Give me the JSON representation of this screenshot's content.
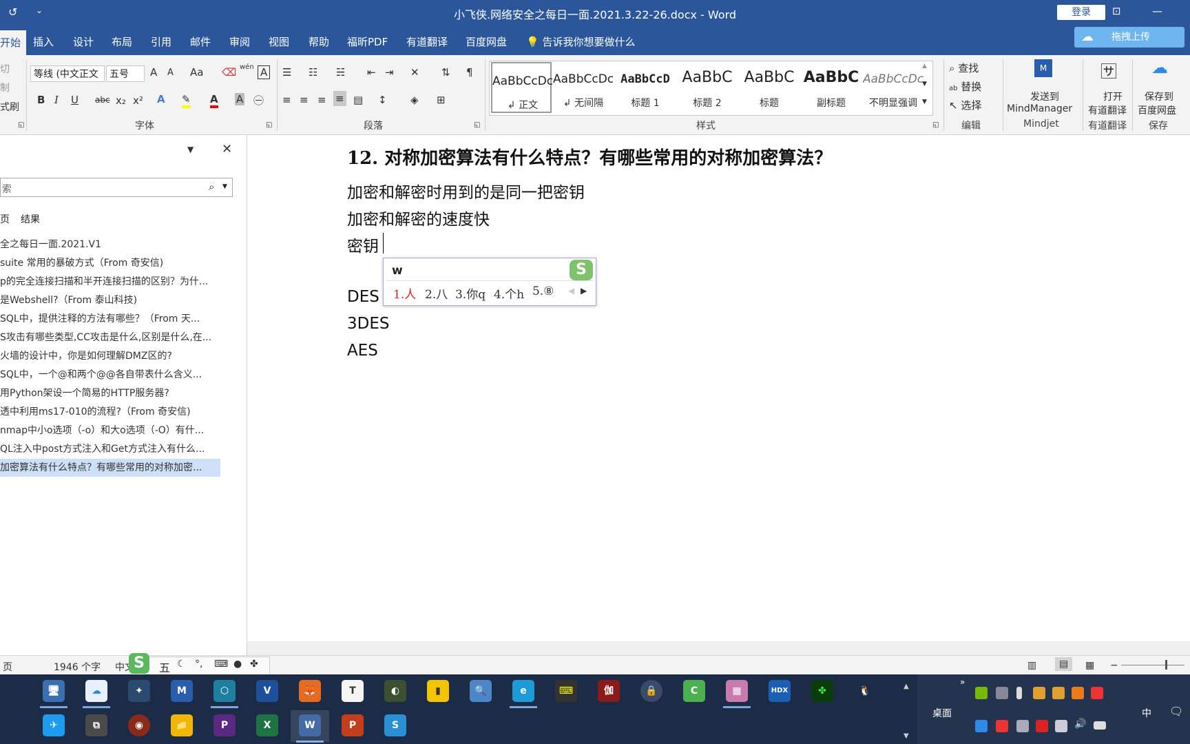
{
  "titlebar": {
    "quick_undo_icon": "undo-circle-icon",
    "quick_customize": "⌄",
    "title": "小飞侠.网络安全之每日一面.2021.3.22-26.docx  -  Word",
    "login": "登录",
    "ribbon_display_icon": "⊡",
    "minimize": "—"
  },
  "tabs": {
    "items": [
      "开始",
      "插入",
      "设计",
      "布局",
      "引用",
      "邮件",
      "审阅",
      "视图",
      "帮助",
      "福昕PDF",
      "有道翻译",
      "百度网盘"
    ],
    "tellme": "告诉我你想要做什么",
    "upload": "拖拽上传"
  },
  "clipboard": {
    "cut": "切",
    "copy": "制",
    "painter": "式刷"
  },
  "font": {
    "name": "等线 (中文正文",
    "size": "五号",
    "grow": "A",
    "shrink": "A",
    "case": "Aa",
    "pinyin": "wén",
    "bold": "B",
    "italic": "I",
    "underline": "U",
    "strike": "abc",
    "sub": "x₂",
    "sup": "x²",
    "group_label": "字体"
  },
  "paragraph": {
    "group_label": "段落"
  },
  "styles": {
    "group_label": "样式",
    "items": [
      {
        "sample": "AaBbCcDc",
        "name": "↲ 正文"
      },
      {
        "sample": "AaBbCcDc",
        "name": "↲ 无间隔"
      },
      {
        "sample": "AaBbCcD",
        "name": "标题 1"
      },
      {
        "sample": "AaBbC",
        "name": "标题 2"
      },
      {
        "sample": "AaBbC",
        "name": "标题"
      },
      {
        "sample": "AaBbC",
        "name": "副标题"
      },
      {
        "sample": "AaBbCcDc",
        "name": "不明显强调"
      }
    ]
  },
  "editing": {
    "find": "查找",
    "replace": "替换",
    "select": "选择",
    "group_label": "编辑"
  },
  "mindjet": {
    "line1": "发送到",
    "line2": "MindManager",
    "group_label": "Mindjet"
  },
  "youdao": {
    "line1": "打开",
    "line2": "有道翻译",
    "group_label": "有道翻译"
  },
  "baidu": {
    "line1": "保存到",
    "line2": "百度网盘",
    "group_label": "保存"
  },
  "nav": {
    "search_placeholder": "索",
    "tab_pages": "页",
    "tab_results": "结果",
    "headings": [
      "全之每日一面.2021.V1",
      "suite 常用的暴破方式（From 奇安信)",
      "p的完全连接扫描和半开连接扫描的区别？为什...",
      "是Webshell?（From  泰山科技)",
      "SQL中，提供注释的方法有哪些？（From 天...",
      "S攻击有哪些类型,CC攻击是什么,区别是什么,在...",
      "火墙的设计中，你是如何理解DMZ区的?",
      "SQL中，一个@和两个@@各自带表什么含义...",
      "用Python架设一个简易的HTTP服务器?",
      "透中利用ms17-010的流程?（From 奇安信)",
      "nmap中小o选项（-o）和大o选项（-O）有什...",
      "QL注入中post方式注入和Get方式注入有什么...",
      "加密算法有什么特点？有哪些常用的对称加密..."
    ]
  },
  "document": {
    "heading": "12.  对称加密算法有什么特点？有哪些常用的对称加密算法？",
    "lines": [
      "加密和解密时用到的是同一把密钥",
      "加密和解密的速度快",
      "密钥"
    ],
    "algos": [
      "DES",
      "3DES",
      "AES"
    ]
  },
  "ime": {
    "input": "w",
    "candidates": [
      "1.人",
      "2.八",
      "3.你q",
      "4.个h",
      "5.⑧"
    ]
  },
  "status": {
    "page": "页",
    "words": "1946 个字",
    "lang": "中文",
    "ime_mode": "五"
  },
  "taskbar": {
    "apps": [
      "🖥",
      "☁",
      "✦",
      "M",
      "⬡",
      "V",
      "🦊",
      "T",
      "◐",
      "▮",
      "🔍",
      "e",
      "⌨",
      "伽",
      "🔒",
      "C",
      "▦",
      "HDX",
      "✤",
      "🐧"
    ],
    "apps_row2": [
      "✈",
      "⧉",
      "◉",
      "📁",
      "P",
      "X",
      "W",
      "P",
      "S"
    ],
    "desktop": "桌面",
    "input_lang": "中"
  }
}
